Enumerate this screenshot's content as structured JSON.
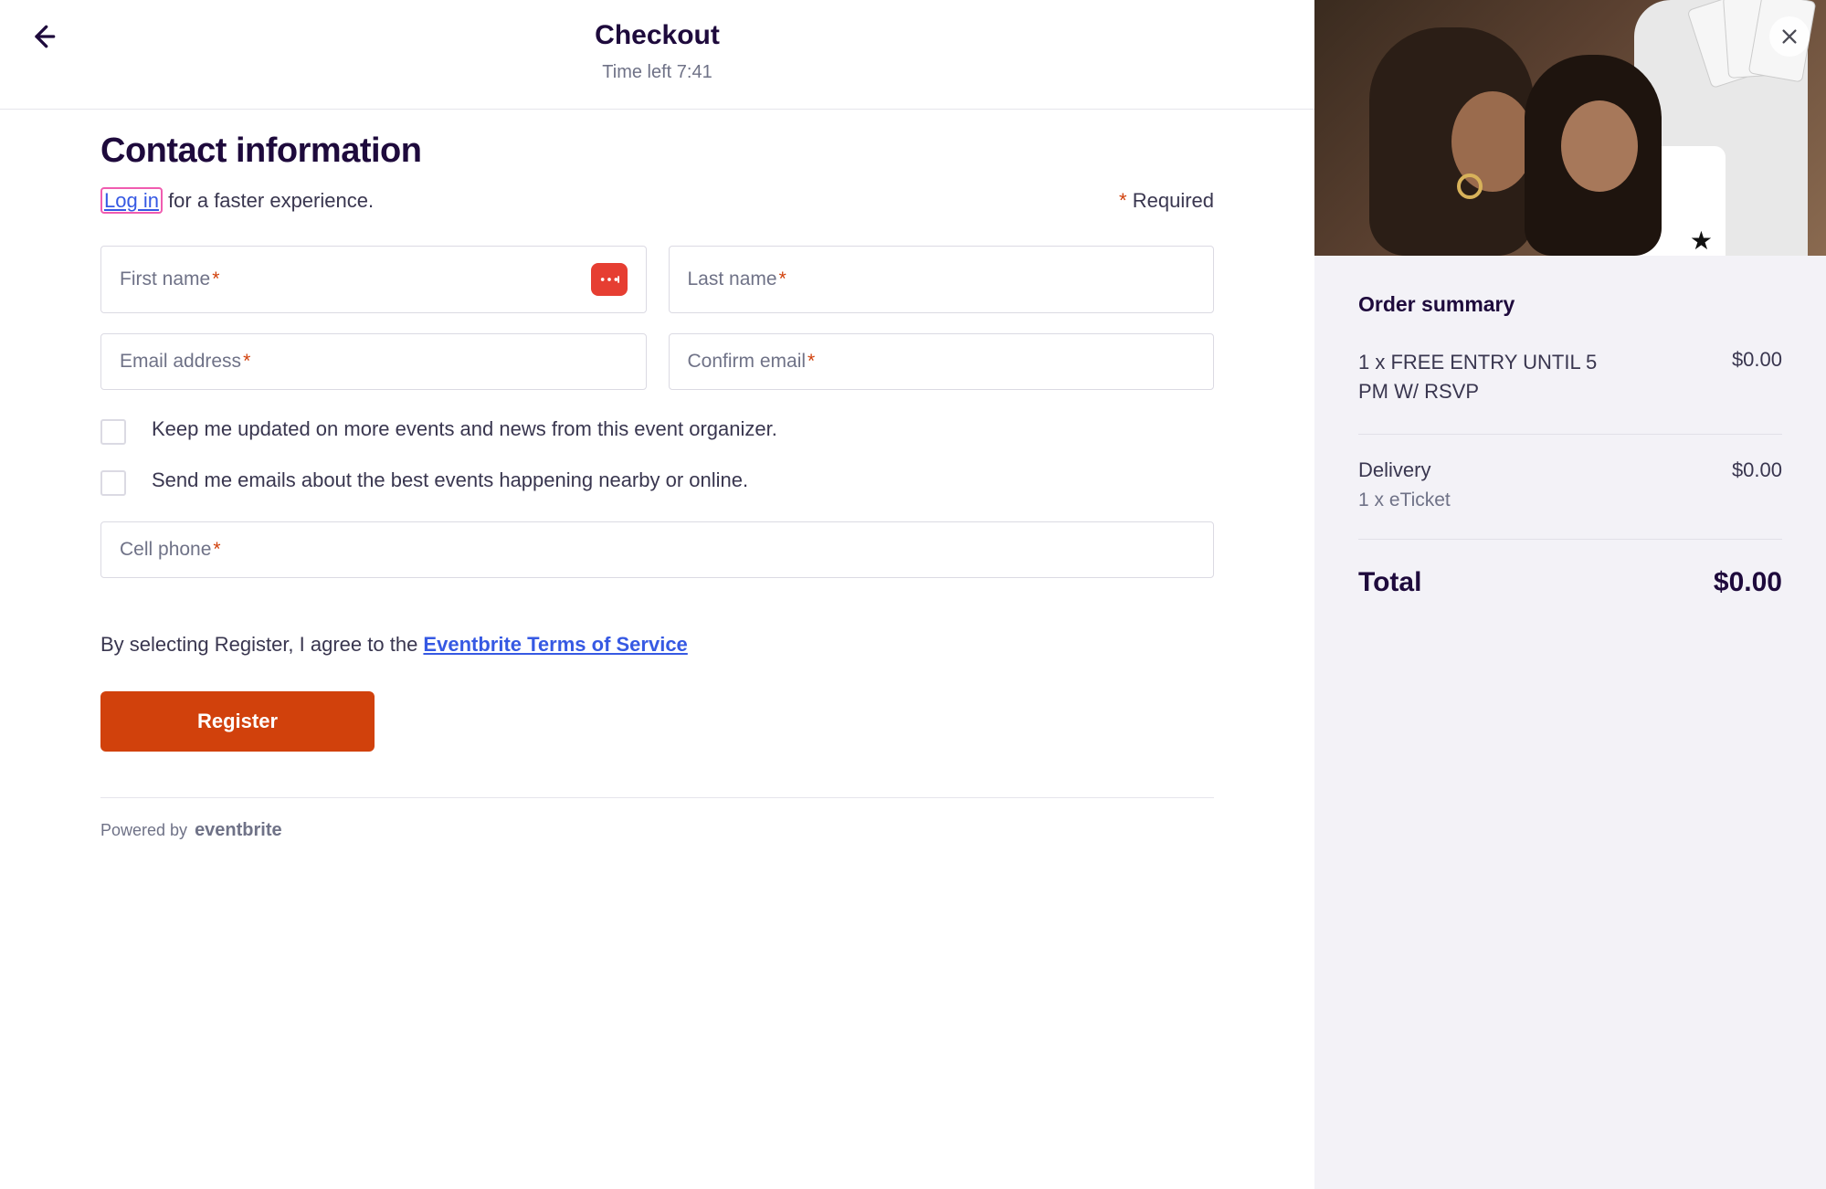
{
  "header": {
    "title": "Checkout",
    "timer_prefix": "Time left ",
    "timer_value": "7:41"
  },
  "contact": {
    "heading": "Contact information",
    "login_link": "Log in",
    "login_rest": " for a faster experience.",
    "required_star": "*",
    "required_label": " Required",
    "fields": {
      "first_name": "First name",
      "last_name": "Last name",
      "email": "Email address",
      "confirm_email": "Confirm email",
      "cell_phone": "Cell phone"
    },
    "checks": {
      "updates": "Keep me updated on more events and news from this event organizer.",
      "nearby": "Send me emails about the best events happening nearby or online."
    },
    "agree_prefix": "By selecting Register, I agree to the ",
    "agree_link": "Eventbrite Terms of Service",
    "register": "Register",
    "powered_prefix": "Powered by ",
    "powered_brand": "eventbrite"
  },
  "summary": {
    "title": "Order summary",
    "item_qty_name": "1 x FREE ENTRY UNTIL 5 PM W/ RSVP",
    "item_price": "$0.00",
    "delivery_label": "Delivery",
    "delivery_price": "$0.00",
    "delivery_sub": "1 x eTicket",
    "total_label": "Total",
    "total_price": "$0.00"
  }
}
